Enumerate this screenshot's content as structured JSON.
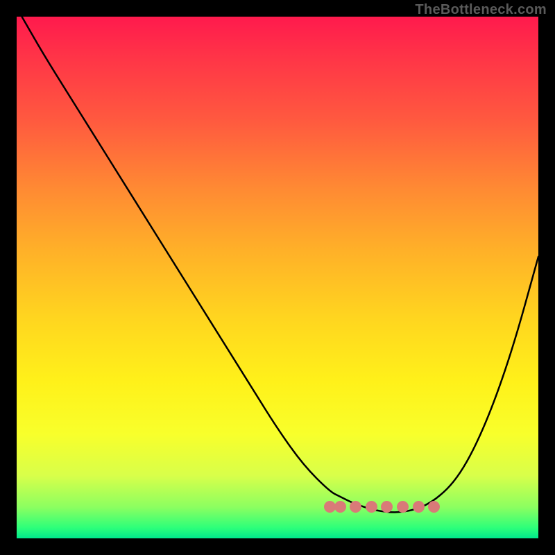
{
  "watermark": "TheBottleneck.com",
  "chart_data": {
    "type": "line",
    "title": "",
    "xlabel": "",
    "ylabel": "",
    "xlim": [
      0,
      100
    ],
    "ylim": [
      0,
      100
    ],
    "series": [
      {
        "name": "curve",
        "x": [
          1,
          5,
          10,
          15,
          20,
          25,
          30,
          35,
          40,
          45,
          50,
          55,
          60,
          62,
          65,
          70,
          75,
          80,
          85,
          90,
          95,
          100
        ],
        "y": [
          100,
          93,
          85,
          77,
          69,
          61,
          53,
          45,
          37,
          29,
          21,
          14,
          9,
          8,
          6.5,
          5,
          5,
          7,
          12,
          22,
          36,
          54
        ]
      }
    ],
    "valley_markers_x": [
      60,
      62,
      65,
      68,
      71,
      74,
      77,
      80
    ],
    "valley_marker_y": 6
  },
  "colors": {
    "curve": "#000000",
    "markers": "#d97a78",
    "background_top": "#ff1a4d",
    "background_bottom": "#00e88c"
  }
}
